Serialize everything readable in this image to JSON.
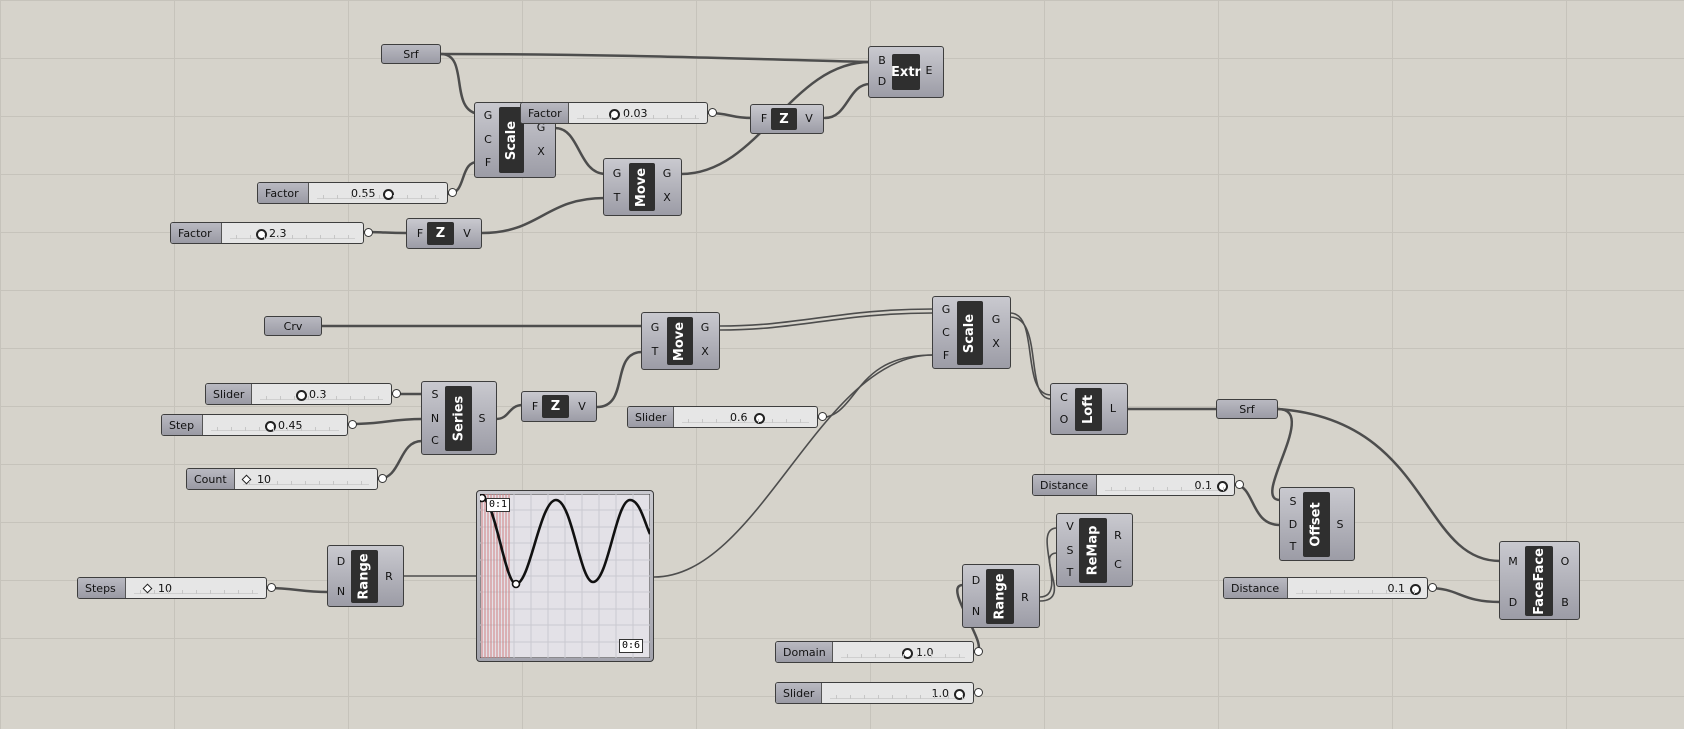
{
  "params": {
    "srf_top": "Srf",
    "crv": "Crv",
    "srf_bottom": "Srf"
  },
  "sliders": {
    "factor_a": {
      "name": "Factor",
      "value": "0.03"
    },
    "factor_b": {
      "name": "Factor",
      "value": "0.55"
    },
    "factor_c": {
      "name": "Factor",
      "value": "2.3"
    },
    "slider_03": {
      "name": "Slider",
      "value": "0.3"
    },
    "step": {
      "name": "Step",
      "value": "0.45"
    },
    "count": {
      "name": "Count",
      "value": "10"
    },
    "slider_06": {
      "name": "Slider",
      "value": "0.6"
    },
    "steps": {
      "name": "Steps",
      "value": "10"
    },
    "distance_a": {
      "name": "Distance",
      "value": "0.1"
    },
    "distance_b": {
      "name": "Distance",
      "value": "0.1"
    },
    "domain": {
      "name": "Domain",
      "value": "1.0"
    },
    "slider_10": {
      "name": "Slider",
      "value": "1.0"
    }
  },
  "components": {
    "scale_top": {
      "title": "Scale",
      "inputs": [
        "G",
        "C",
        "F"
      ],
      "outputs": [
        "G",
        "X"
      ]
    },
    "move_top": {
      "title": "Move",
      "inputs": [
        "G",
        "T"
      ],
      "outputs": [
        "G",
        "X"
      ]
    },
    "z_top": {
      "title": "Z",
      "inputs": [
        "F"
      ],
      "outputs": [
        "V"
      ]
    },
    "z_mid": {
      "title": "Z",
      "inputs": [
        "F"
      ],
      "outputs": [
        "V"
      ]
    },
    "extr": {
      "title": "Extr",
      "inputs": [
        "B",
        "D"
      ],
      "outputs": [
        "E"
      ]
    },
    "move_bottom": {
      "title": "Move",
      "inputs": [
        "G",
        "T"
      ],
      "outputs": [
        "G",
        "X"
      ]
    },
    "scale_bottom": {
      "title": "Scale",
      "inputs": [
        "G",
        "C",
        "F"
      ],
      "outputs": [
        "G",
        "X"
      ]
    },
    "series": {
      "title": "Series",
      "inputs": [
        "S",
        "N",
        "C"
      ],
      "outputs": [
        "S"
      ]
    },
    "z_bottom": {
      "title": "Z",
      "inputs": [
        "F"
      ],
      "outputs": [
        "V"
      ]
    },
    "loft": {
      "title": "Loft",
      "inputs": [
        "C",
        "O"
      ],
      "outputs": [
        "L"
      ]
    },
    "range_left": {
      "title": "Range",
      "inputs": [
        "D",
        "N"
      ],
      "outputs": [
        "R"
      ]
    },
    "range_right": {
      "title": "Range",
      "inputs": [
        "D",
        "N"
      ],
      "outputs": [
        "R"
      ]
    },
    "remap": {
      "title": "ReMap",
      "inputs": [
        "V",
        "S",
        "T"
      ],
      "outputs": [
        "R",
        "C"
      ]
    },
    "offset": {
      "title": "Offset",
      "inputs": [
        "S",
        "D",
        "T"
      ],
      "outputs": [
        "S"
      ]
    },
    "faceface": {
      "title": "FaceFace",
      "inputs": [
        "M",
        "D"
      ],
      "outputs": [
        "O",
        "B"
      ]
    }
  },
  "graph_mapper": {
    "top_left_label": "0:1",
    "bottom_right_label": "0:6"
  },
  "colors": {
    "canvas": "#d6d3cb",
    "wire": "#4d4d4d",
    "component": "#a3a3ad",
    "title_block": "#2f2f2f"
  }
}
